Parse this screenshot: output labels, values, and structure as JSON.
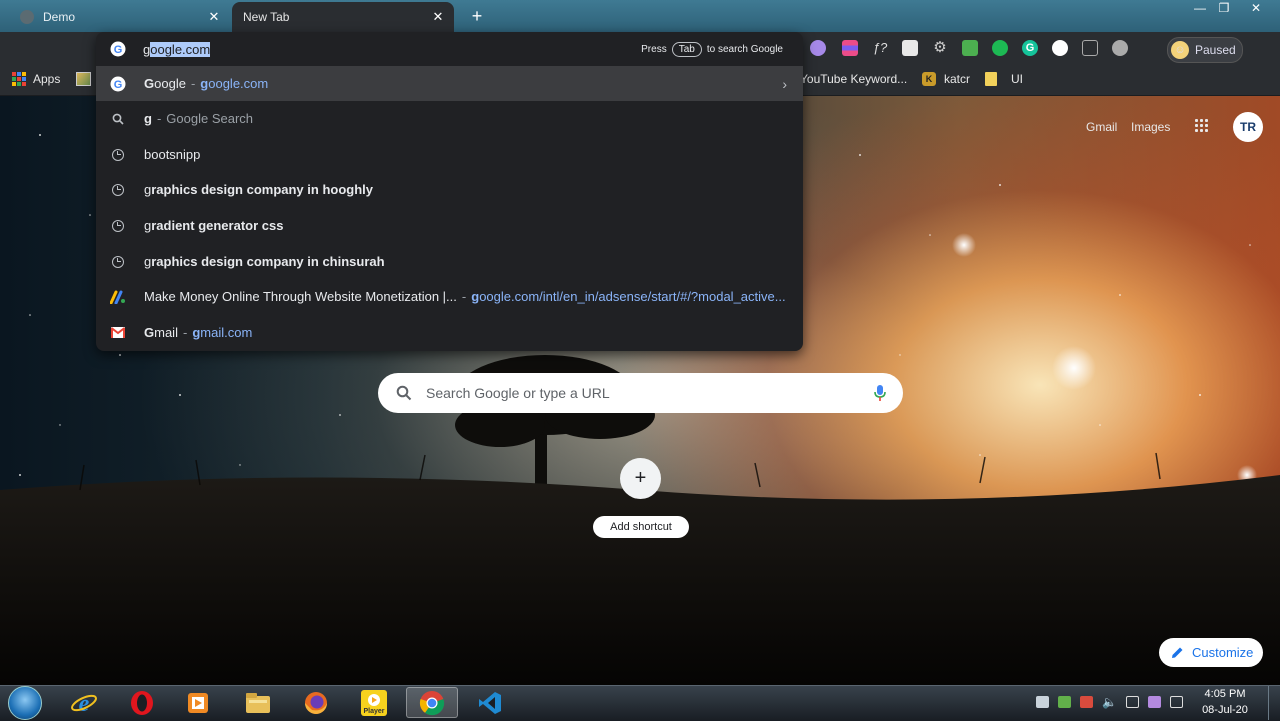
{
  "tabs": [
    {
      "title": "Demo",
      "active": false
    },
    {
      "title": "New Tab",
      "active": true
    }
  ],
  "window_controls": {
    "minimize": "minimize-icon",
    "restore": "restore-icon",
    "close": "close-icon"
  },
  "toolbar": {
    "profile_label": "Paused"
  },
  "bookmarks": {
    "apps": "Apps",
    "youtube": "YouTube Keyword...",
    "katcr": "katcr",
    "ui": "UI"
  },
  "omnibox": {
    "typed": "g",
    "autocomplete": "oogle.com",
    "press": "Press",
    "tab_key": "Tab",
    "to_search": "to search Google"
  },
  "suggestions": [
    {
      "icon": "google-icon",
      "title_bold": "G",
      "title_rest": "oogle",
      "sep": "-",
      "url_bold": "g",
      "url_rest": "oogle.com",
      "highlighted": true
    },
    {
      "icon": "search-icon",
      "title_bold": "g",
      "title_rest": "",
      "sep": "-",
      "sub": "Google Search"
    },
    {
      "icon": "history-icon",
      "text": "bootsnipp"
    },
    {
      "icon": "history-icon",
      "text_prefix": "g",
      "text_bold": "raphics design company in hooghly"
    },
    {
      "icon": "history-icon",
      "text_prefix": "g",
      "text_bold": "radient generator css"
    },
    {
      "icon": "history-icon",
      "text_prefix": "g",
      "text_bold": "raphics design company in chinsurah"
    },
    {
      "icon": "adsense-icon",
      "text": "Make Money Online Through Website Monetization |...",
      "sep": "-",
      "url_bold": "g",
      "url_rest": "oogle.com/intl/en_in/adsense/start/#/?modal_active..."
    },
    {
      "icon": "gmail-icon",
      "title_bold": "G",
      "title_rest": "mail",
      "sep": "-",
      "url_bold": "g",
      "url_rest": "mail.com"
    }
  ],
  "ntp": {
    "gmail": "Gmail",
    "images": "Images",
    "avatar_initials": "TR",
    "search_placeholder": "Search Google or type a URL",
    "add_shortcut": "Add shortcut",
    "add_shortcut_symbol": "+",
    "customize": "Customize"
  },
  "taskbar": {
    "items": [
      "internet-explorer-icon",
      "opera-icon",
      "media-player-icon",
      "file-explorer-icon",
      "firefox-icon",
      "player-icon",
      "chrome-icon",
      "vscode-icon"
    ],
    "player_label": "Player",
    "time": "4:05 PM",
    "date": "08-Jul-20"
  },
  "colors": {
    "accent": "#1a73e8",
    "omnibox_bg": "#202124",
    "link_blue": "#8ab4f8",
    "titlebar": "#3f7a93"
  }
}
